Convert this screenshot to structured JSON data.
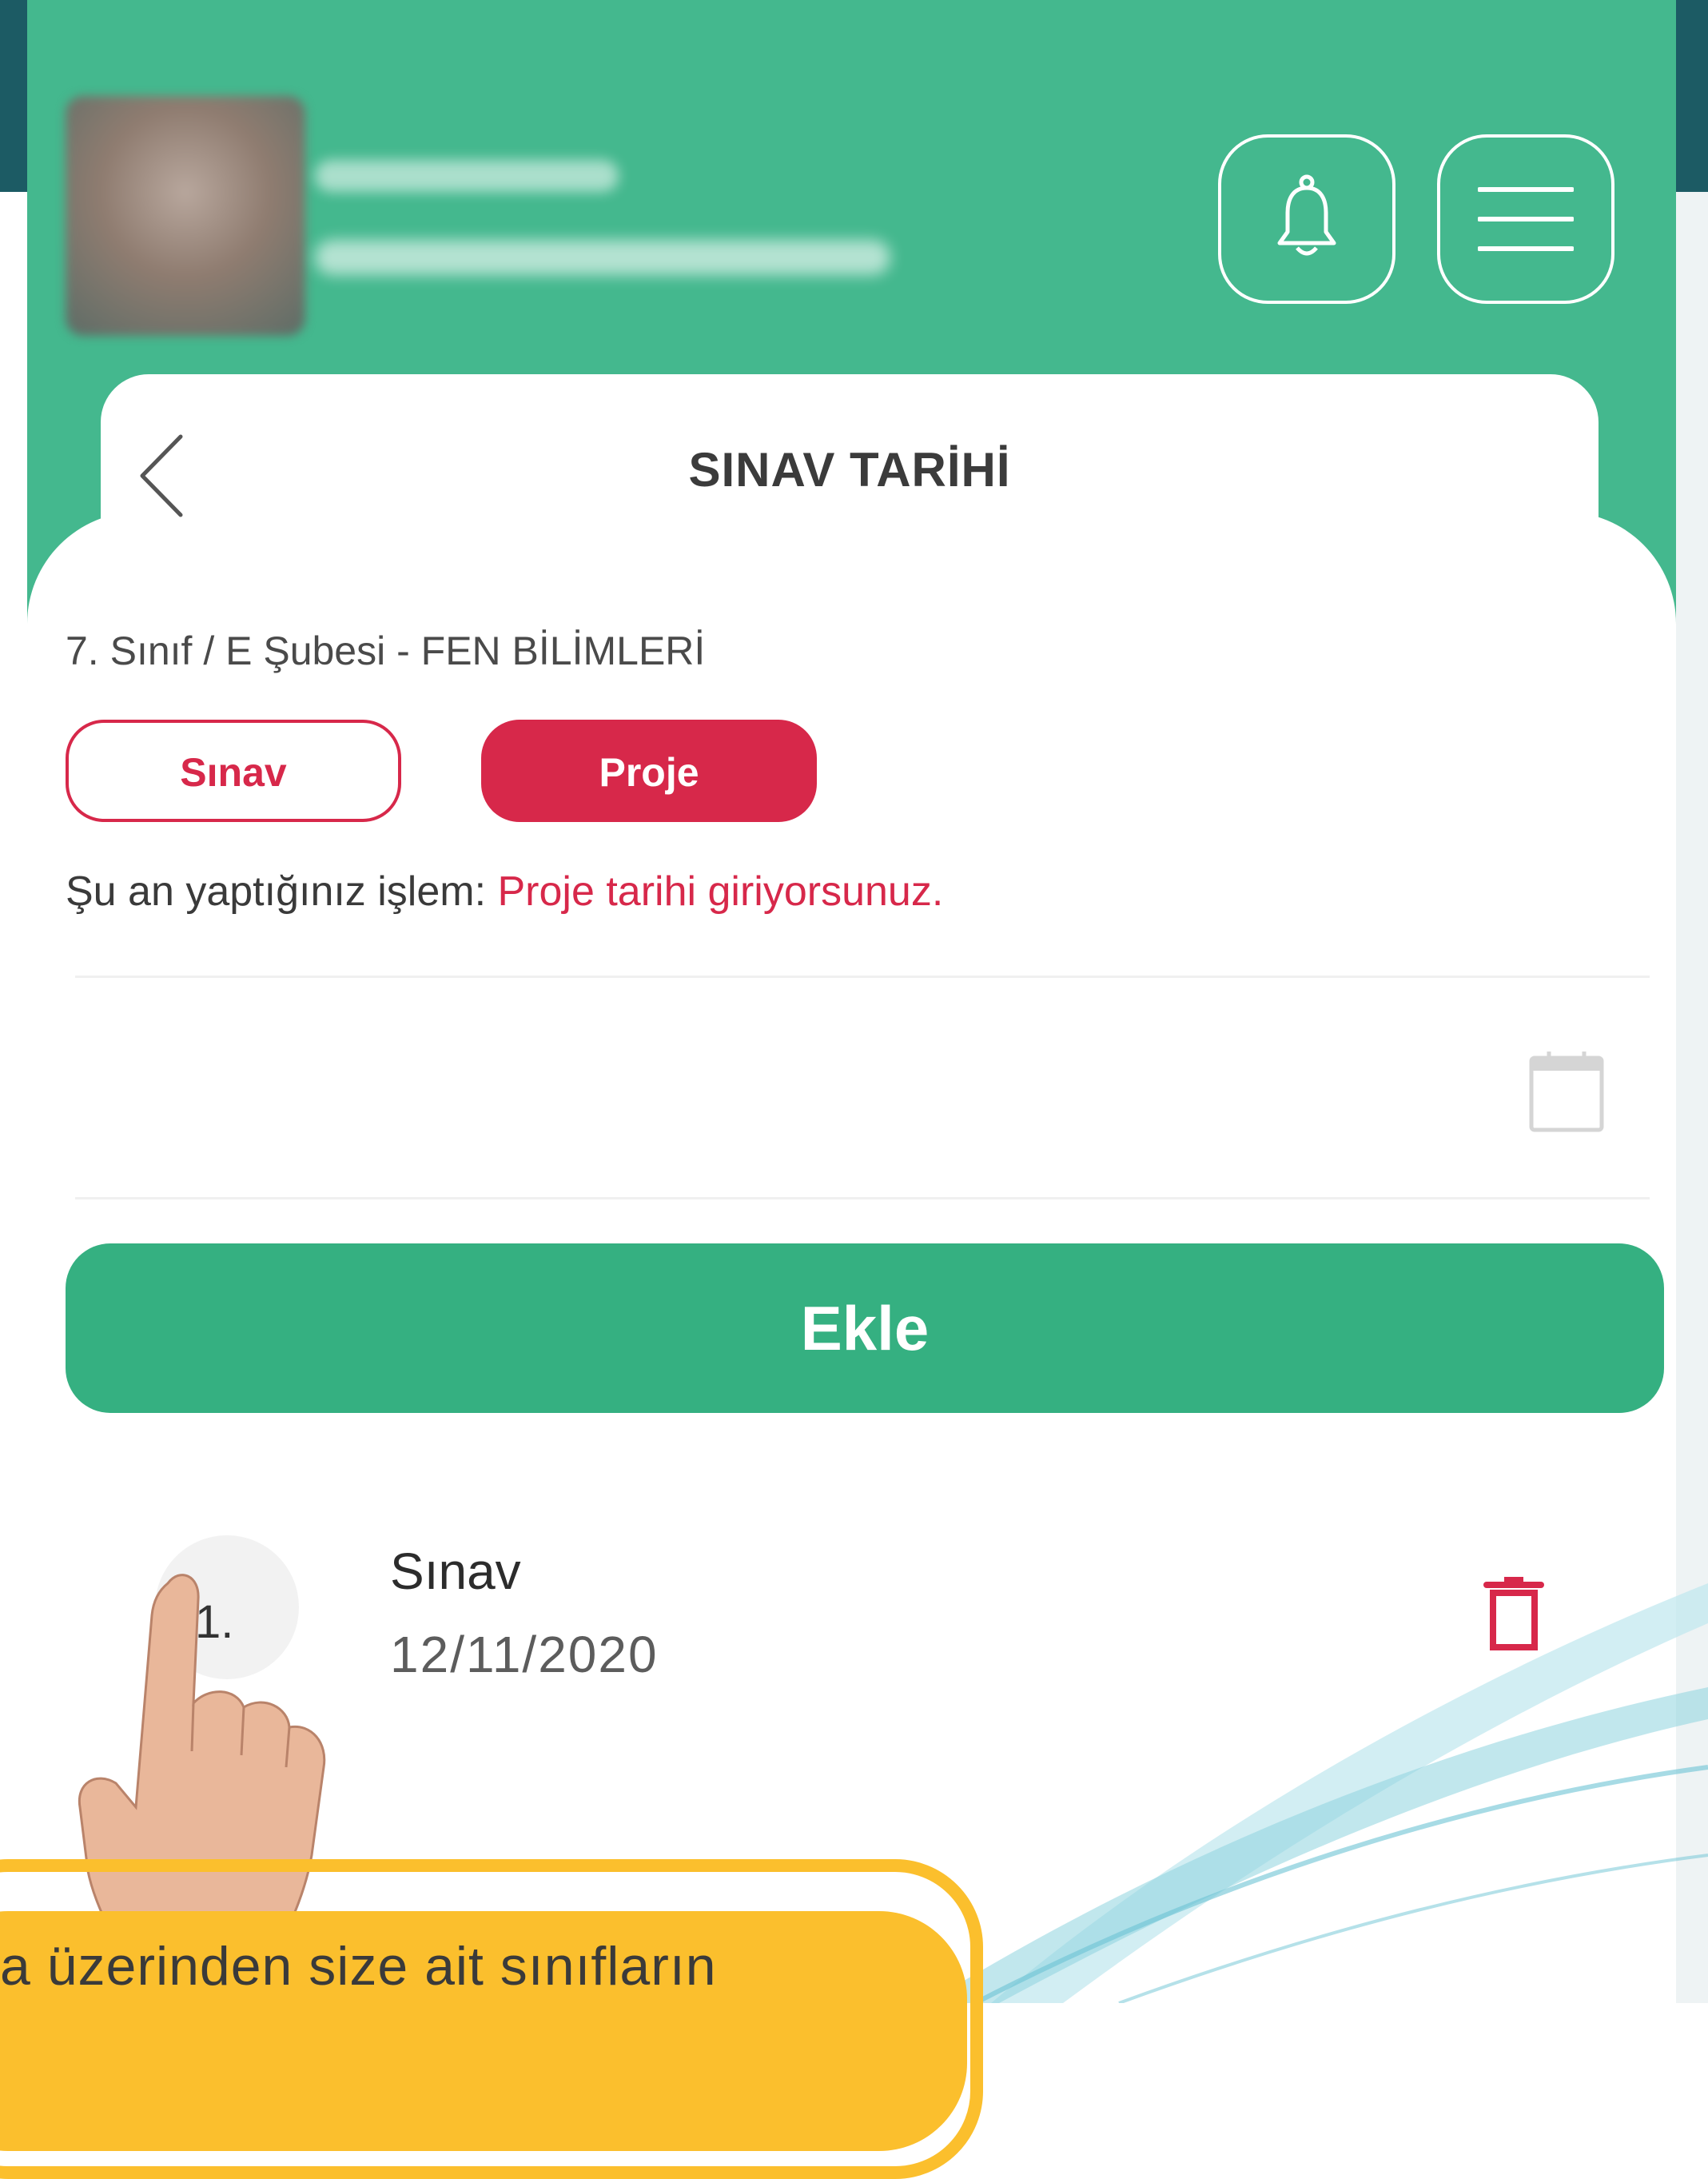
{
  "header": {
    "user_name": "",
    "user_school": "",
    "page_title": "SINAV TARİHİ"
  },
  "content": {
    "class_label": "7. Sınıf / E Şubesi - FEN BİLİMLERİ",
    "tabs": [
      {
        "label": "Sınav",
        "selected": false
      },
      {
        "label": "Proje",
        "selected": true
      }
    ],
    "status_prefix": "Şu an yaptığınız işlem: ",
    "status_value": "Proje tarihi giriyorsunuz.",
    "date_value": "",
    "add_label": "Ekle",
    "items": [
      {
        "index": "1.",
        "title": "Sınav",
        "date": "12/11/2020"
      }
    ]
  },
  "caption": {
    "text": "a üzerinden  size ait sınıfların"
  },
  "colors": {
    "header": "#44b88e",
    "primary": "#35b081",
    "accent": "#d7284a",
    "caption": "#fbbf2d"
  },
  "icons": [
    "back-chevron-icon",
    "bell-icon",
    "menu-icon",
    "calendar-icon",
    "trash-icon",
    "pointing-hand-icon"
  ]
}
